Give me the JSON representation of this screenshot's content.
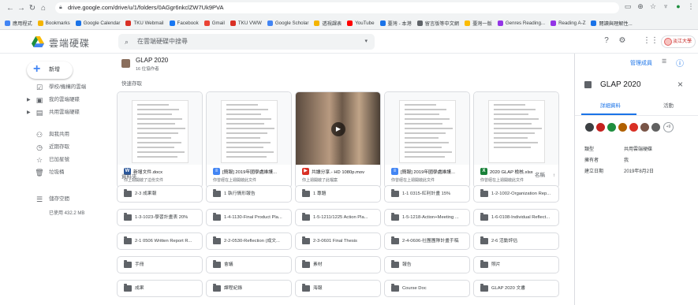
{
  "browser": {
    "url": "drive.google.com/drive/u/1/folders/0AGgr6nkclZW7Uk9PVA",
    "bookmarks": [
      "應用程式",
      "Bookmarks",
      "Google Calendar",
      "TKU Webmail",
      "Facebook",
      "Gmail",
      "TKU VWW",
      "Google Scholar",
      "透視課表",
      "YouTube",
      "臺灣 - 本港",
      "留言版等中文網",
      "臺灣一版",
      "Genres Reading...",
      "Reading A-Z",
      "閱讀與理解性..."
    ]
  },
  "app": {
    "brand": "雲端硬碟",
    "search_placeholder": "在雲端硬碟中搜尋"
  },
  "sidebar": {
    "new_label": "新增",
    "items": [
      {
        "label": "學校/機構的雲端",
        "icon": "checkbox-icon"
      },
      {
        "label": "我的雲端硬碟",
        "icon": "drive-icon"
      },
      {
        "label": "共用雲端硬碟",
        "icon": "shared-drive-icon"
      },
      {
        "label": "與我共用",
        "icon": "people-icon"
      },
      {
        "label": "近期存取",
        "icon": "clock-icon"
      },
      {
        "label": "已加星號",
        "icon": "star-icon"
      },
      {
        "label": "垃圾桶",
        "icon": "trash-icon"
      },
      {
        "label": "儲存空間",
        "icon": "storage-icon"
      }
    ],
    "storage_text": "已使用 432.2 MB"
  },
  "main": {
    "folder_title": "GLAP 2020",
    "folder_subtitle": "16 位協作者",
    "quick_access_label": "快速存取",
    "folders_label": "資料夾",
    "sort_label": "名稱",
    "quick_files": [
      {
        "name": "新增文件.docx",
        "sub": "你上週開啟了這份文件",
        "type": "W",
        "color": "#2b579a",
        "kind": "doc"
      },
      {
        "name": "[簡報] 2019年國學處維護...",
        "sub": "你曾經在上週開啟此文件",
        "type": "≡",
        "color": "#4285f4",
        "kind": "doc"
      },
      {
        "name": "共讀分享.- HD 1080p.mov",
        "sub": "你上週開啟了此檔案",
        "type": "▶",
        "color": "#d93025",
        "kind": "video"
      },
      {
        "name": "[簡報] 2019年國學處維護...",
        "sub": "你曾經在上週開啟此文件",
        "type": "≡",
        "color": "#4285f4",
        "kind": "doc"
      },
      {
        "name": "2020 GLAP 檢核.xlsx",
        "sub": "你曾經在上週開啟此文件",
        "type": "X",
        "color": "#188038",
        "kind": "sheet"
      }
    ],
    "folders": [
      "2-3 成果報",
      "1 執行情形報告",
      "1 專題",
      "1-1 0315-紅利計畫 15%",
      "1-2-1002-Organization Rep...",
      "1-3-1023-學習計畫表 20%",
      "1-4-1130-Final Product Pla...",
      "1-5-1211/1225 Action Pla...",
      "1-5-1218-Action+Meeting ...",
      "1-6-0108-Individual Reflect...",
      "2-1 0506 Written Report R...",
      "2-2-0530-Reflection (成文...",
      "2-3-0601 Final Thesis",
      "2-4-0606-社團團隊計畫手稿",
      "2-6 活動評估",
      "手冊",
      "會議",
      "素材",
      "報告",
      "照片",
      "成果",
      "課程紀錄",
      "海報",
      "Course Doc",
      "GLAP 2020 文書"
    ]
  },
  "panel": {
    "manage_label": "管理成員",
    "title": "GLAP 2020",
    "tab_details": "詳細資料",
    "tab_activity": "活動",
    "rows": [
      {
        "label": "類型",
        "value": "共用雲端硬碟"
      },
      {
        "label": "擁有者",
        "value": "我"
      },
      {
        "label": "建立日期",
        "value": "2019年8月2日"
      }
    ],
    "avatar_colors": [
      "#3c4043",
      "#c5221f",
      "#1e8e3e",
      "#b06000",
      "#d93025",
      "#795548",
      "#616161"
    ],
    "avatar_more": "+9"
  }
}
